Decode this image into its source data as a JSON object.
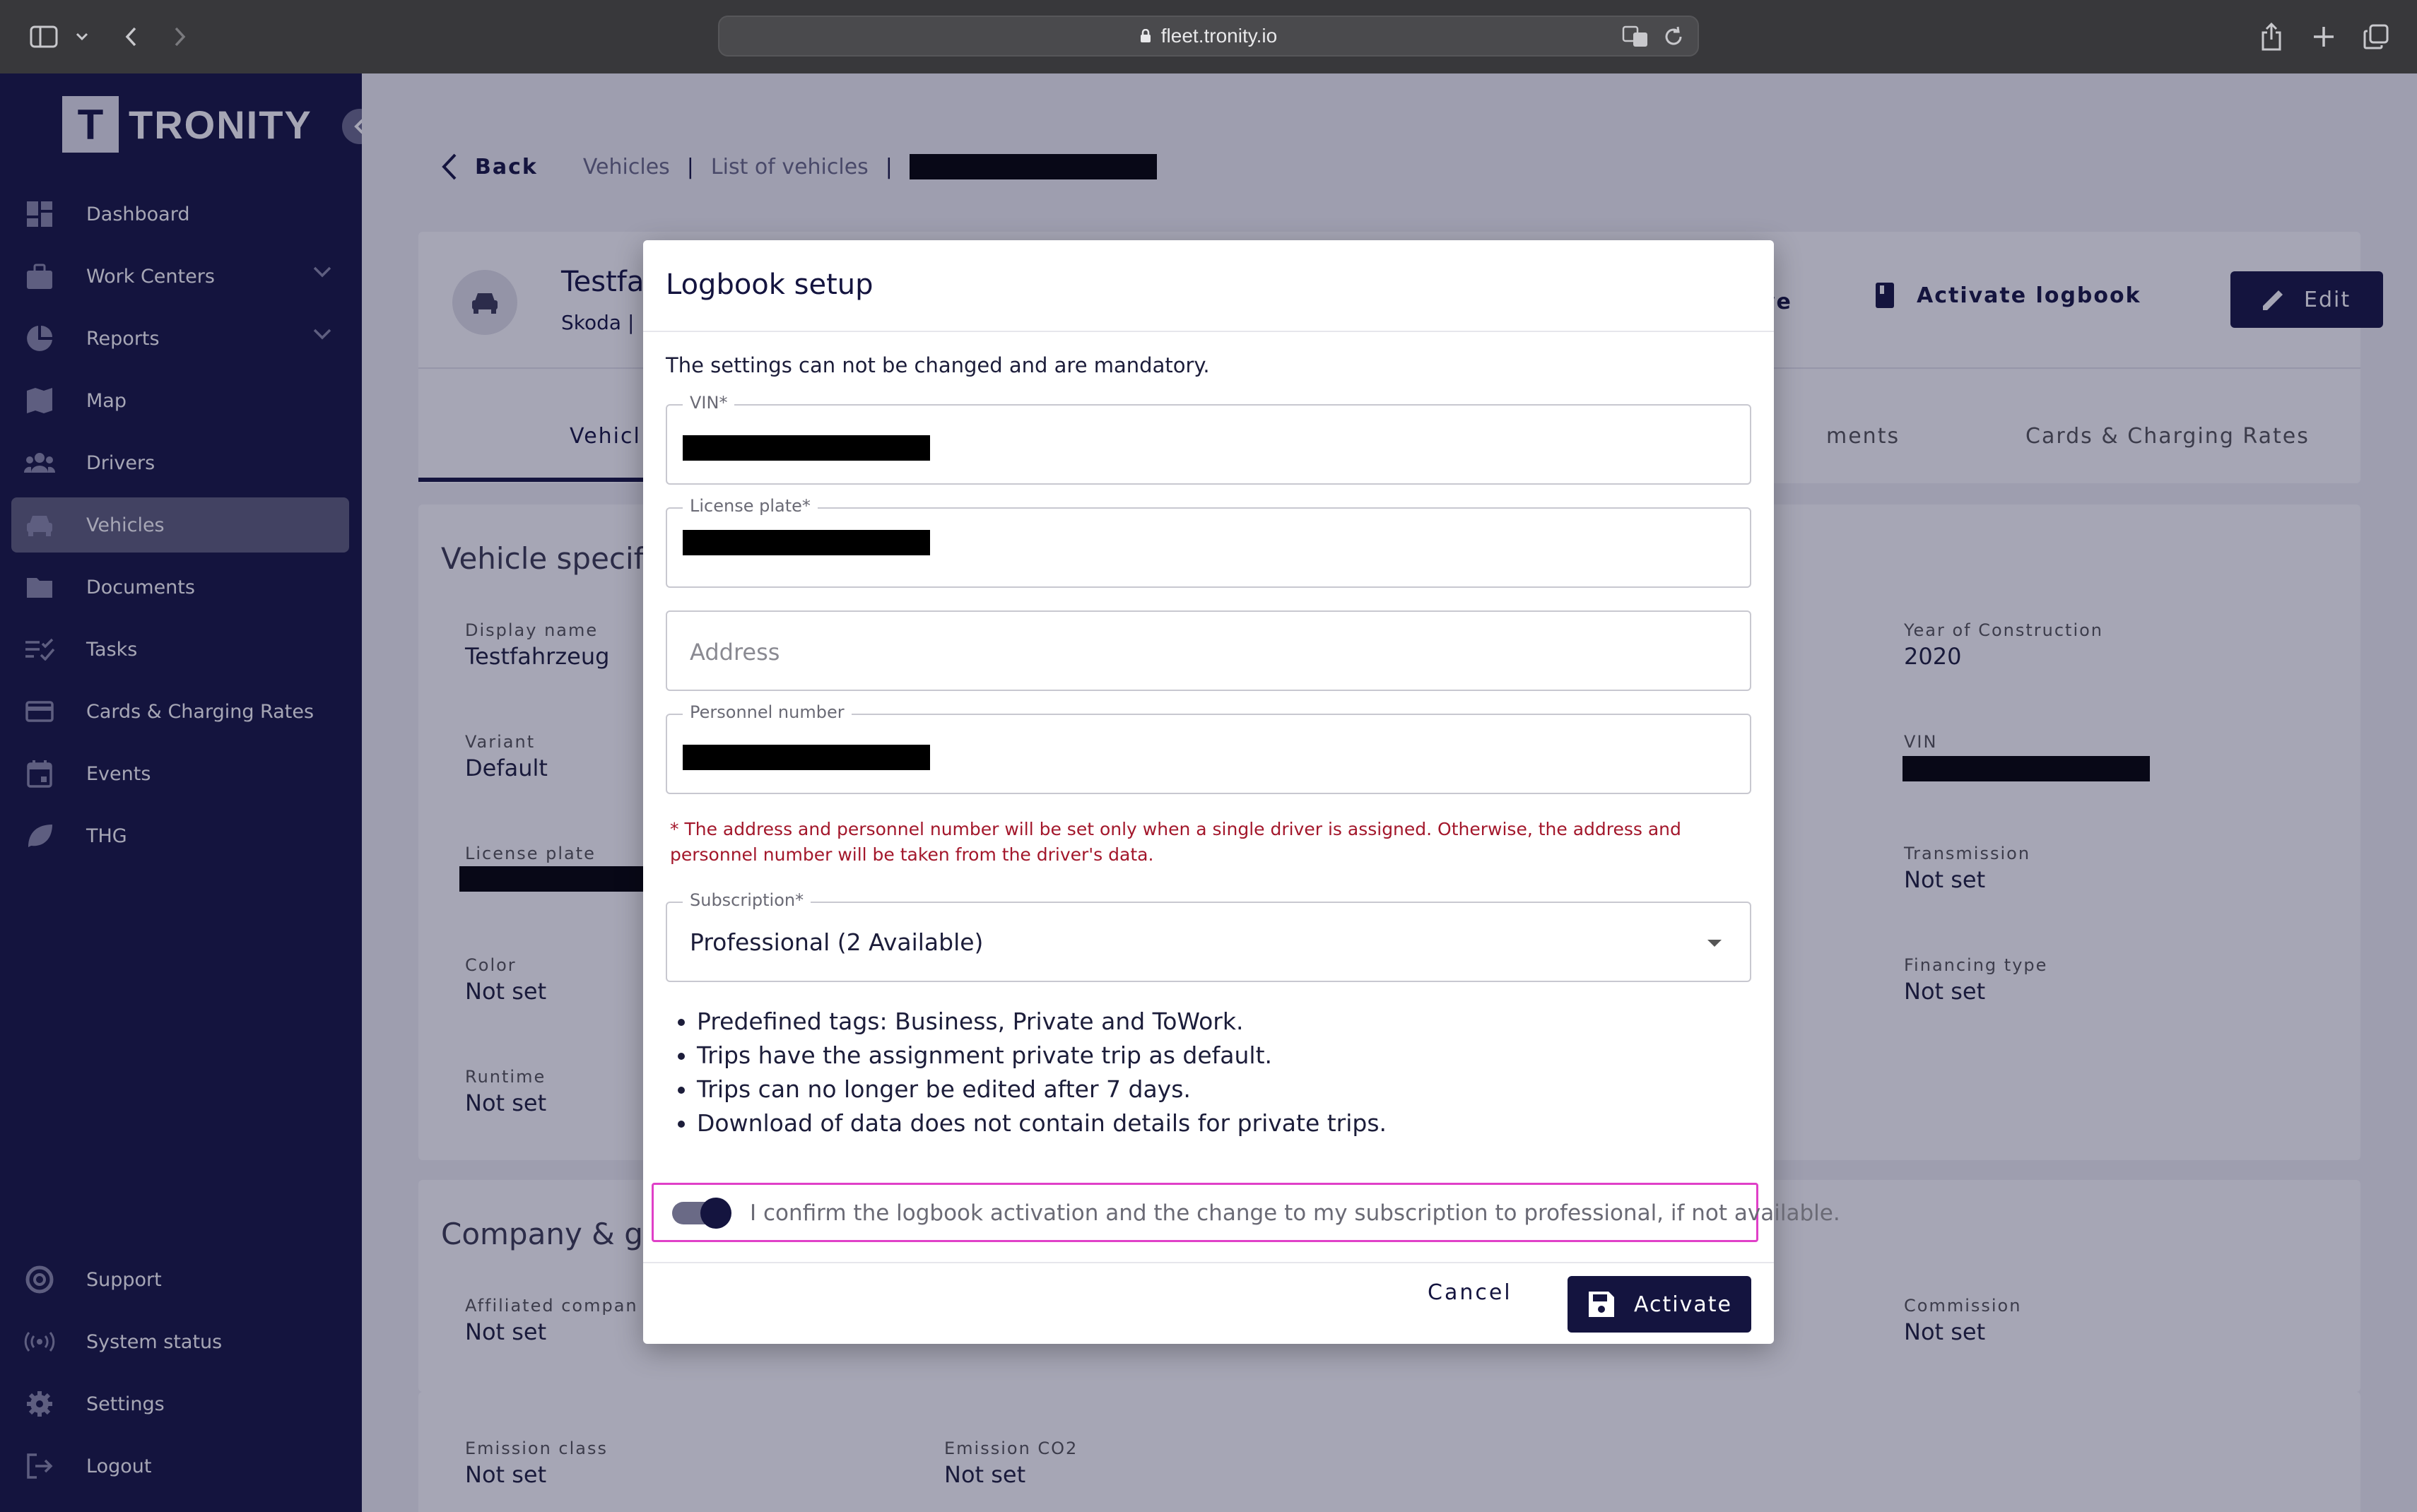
{
  "browser": {
    "url": "fleet.tronity.io"
  },
  "sidebar": {
    "brand": "TRONITY",
    "brand_initial": "T",
    "items": [
      {
        "label": "Dashboard",
        "icon": "dashboard-icon"
      },
      {
        "label": "Work Centers",
        "icon": "briefcase-icon",
        "expandable": true
      },
      {
        "label": "Reports",
        "icon": "pie-chart-icon",
        "expandable": true
      },
      {
        "label": "Map",
        "icon": "map-icon"
      },
      {
        "label": "Drivers",
        "icon": "people-icon"
      },
      {
        "label": "Vehicles",
        "icon": "car-icon",
        "active": true
      },
      {
        "label": "Documents",
        "icon": "folder-icon"
      },
      {
        "label": "Tasks",
        "icon": "checklist-icon"
      },
      {
        "label": "Cards & Charging Rates",
        "icon": "card-icon"
      },
      {
        "label": "Events",
        "icon": "calendar-icon"
      },
      {
        "label": "THG",
        "icon": "leaf-icon"
      }
    ],
    "bottom_items": [
      {
        "label": "Support",
        "icon": "lifebuoy-icon"
      },
      {
        "label": "System status",
        "icon": "broadcast-icon"
      },
      {
        "label": "Settings",
        "icon": "gear-icon"
      },
      {
        "label": "Logout",
        "icon": "logout-icon"
      }
    ]
  },
  "breadcrumb": {
    "back": "Back",
    "items": [
      "Vehicles",
      "List of vehicles"
    ]
  },
  "vehicle_header": {
    "name": "Testfahrzeug",
    "sub": "Skoda | ",
    "save_label": "ve",
    "activate_logbook": "Activate logbook",
    "edit": "Edit"
  },
  "tabs": [
    "Vehicle",
    "Documents",
    "Cards & Charging Rates"
  ],
  "tabs_visible": {
    "left": "Vehicl",
    "middle": "ments",
    "right": "Cards & Charging Rates"
  },
  "specs": {
    "section_title": "Vehicle specif",
    "left": [
      {
        "label": "Display name",
        "value": "Testfahrzeug"
      },
      {
        "label": "Variant",
        "value": "Default"
      },
      {
        "label": "License plate",
        "value": ""
      },
      {
        "label": "Color",
        "value": "Not set"
      },
      {
        "label": "Runtime",
        "value": "Not set"
      }
    ],
    "right": [
      {
        "label": "Year of Construction",
        "value": "2020"
      },
      {
        "label": "VIN",
        "value": ""
      },
      {
        "label": "Transmission",
        "value": "Not set"
      },
      {
        "label": "Financing type",
        "value": "Not set"
      }
    ]
  },
  "company": {
    "section_title": "Company & g",
    "left": {
      "label": "Affiliated compan",
      "value": "Not set"
    },
    "right": {
      "label": "Commission",
      "value": "Not set"
    }
  },
  "emissions": [
    {
      "label": "Emission class",
      "value": "Not set"
    },
    {
      "label": "Emission CO2",
      "value": "Not set"
    }
  ],
  "modal": {
    "title": "Logbook setup",
    "info": "The settings can not be changed and are mandatory.",
    "vin_label": "VIN*",
    "plate_label": "License plate*",
    "address_placeholder": "Address",
    "personnel_label": "Personnel number",
    "note": "* The address and personnel number will be set only when a single driver is assigned. Otherwise, the address and personnel number will be taken from the driver's data.",
    "subscription_label": "Subscription*",
    "subscription_value": "Professional (2 Available)",
    "bullets": [
      "Predefined tags: Business, Private and ToWork.",
      "Trips have the assignment private trip as default.",
      "Trips can no longer be edited after 7 days.",
      "Download of data does not contain details for private trips."
    ],
    "confirm_text": "I confirm the logbook activation and the change to my subscription to professional, if not available.",
    "confirm_on": true,
    "cancel": "Cancel",
    "activate": "Activate"
  }
}
